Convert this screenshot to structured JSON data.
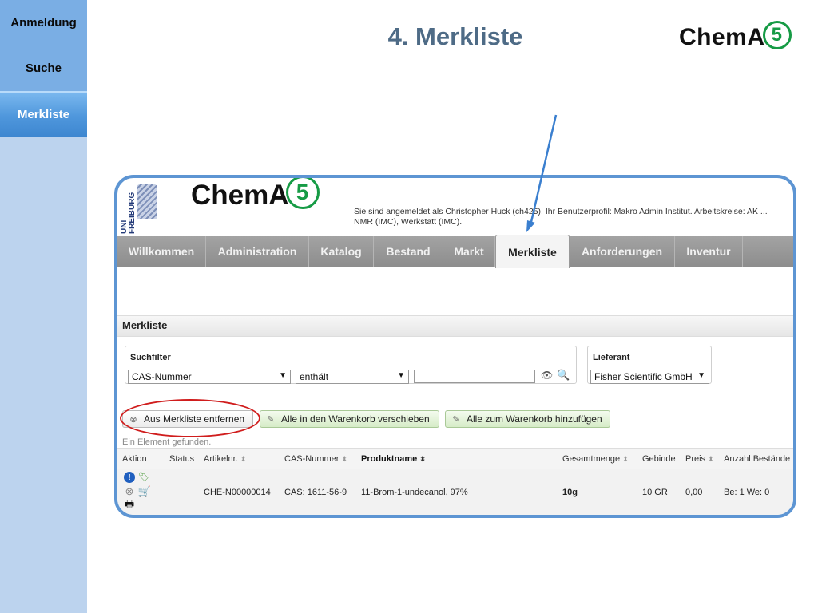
{
  "slide": {
    "title": "4. Merkliste",
    "nav": [
      "Anmeldung",
      "Suche",
      "Merkliste"
    ],
    "logo": {
      "text": "ChemA",
      "number": "5"
    }
  },
  "app": {
    "uni_logo_text": "UNI FREIBURG",
    "logo": {
      "text": "ChemA",
      "number": "5"
    },
    "login_info_line1": "Sie sind angemeldet als Christopher Huck (ch425). Ihr Benutzerprofil: Makro Admin Institut. Arbeitskreise: AK ...",
    "login_info_line2": "NMR (IMC), Werkstatt (IMC).",
    "menu": [
      "Willkommen",
      "Administration",
      "Katalog",
      "Bestand",
      "Markt",
      "Merkliste",
      "Anforderungen",
      "Inventur"
    ],
    "active_menu": "Merkliste",
    "section_title": "Merkliste",
    "search_filter": {
      "label": "Suchfilter",
      "field": "CAS-Nummer",
      "operator": "enthält",
      "value": ""
    },
    "supplier": {
      "label": "Lieferant",
      "value": "Fisher Scientific GmbH"
    },
    "buttons": {
      "remove": "Aus Merkliste entfernen",
      "move_all": "Alle in den Warenkorb verschieben",
      "add_all": "Alle zum Warenkorb hinzufügen"
    },
    "result_count": "Ein Element gefunden.",
    "table": {
      "headers": [
        "Aktion",
        "Status",
        "Artikelnr.",
        "CAS-Nummer",
        "Produktname",
        "Gesamtmenge",
        "Gebinde",
        "Preis",
        "Anzahl Bestände"
      ],
      "rows": [
        {
          "status": "",
          "artikelnr": "CHE-N00000014",
          "cas": "CAS: 1611-56-9",
          "produktname": "11-Brom-1-undecanol, 97%",
          "gesamtmenge": "10g",
          "gebinde": "10 GR",
          "preis": "0,00",
          "bestaende": "Be: 1 We: 0"
        }
      ]
    }
  },
  "colors": {
    "nav_bg": "#bcd3ee",
    "nav_item": "#7aaee4",
    "title": "#4e6b86",
    "frame_border": "#5d95d3",
    "logo_green": "#169b45",
    "highlight_oval": "#d01d1d",
    "annotation_arrow": "#3a7fcf"
  }
}
